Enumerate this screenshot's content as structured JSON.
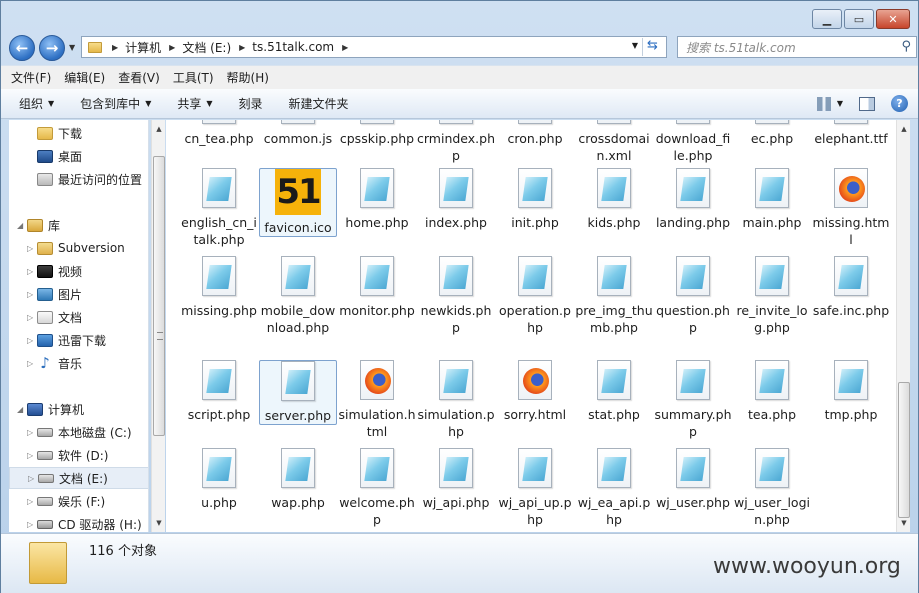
{
  "address": {
    "crumbs": [
      "计算机",
      "文档 (E:)",
      "ts.51talk.com"
    ]
  },
  "search": {
    "placeholder": "搜索 ts.51talk.com"
  },
  "menu": [
    "文件(F)",
    "编辑(E)",
    "查看(V)",
    "工具(T)",
    "帮助(H)"
  ],
  "toolbar": {
    "organize": "组织",
    "include": "包含到库中",
    "share": "共享",
    "burn": "刻录",
    "new_folder": "新建文件夹"
  },
  "sidebar": {
    "items": [
      {
        "label": "下载",
        "icon": "folder-icon"
      },
      {
        "label": "桌面",
        "icon": "desktop-icon"
      },
      {
        "label": "最近访问的位置",
        "icon": "recent-places-icon"
      },
      {
        "label": "库",
        "icon": "library-icon"
      },
      {
        "label": "Subversion",
        "icon": "folder-icon"
      },
      {
        "label": "视频",
        "icon": "video-library-icon"
      },
      {
        "label": "图片",
        "icon": "pictures-library-icon"
      },
      {
        "label": "文档",
        "icon": "documents-library-icon"
      },
      {
        "label": "迅雷下载",
        "icon": "download-library-icon"
      },
      {
        "label": "音乐",
        "icon": "music-library-icon"
      },
      {
        "label": "计算机",
        "icon": "computer-icon"
      },
      {
        "label": "本地磁盘 (C:)",
        "icon": "drive-icon"
      },
      {
        "label": "软件 (D:)",
        "icon": "drive-icon"
      },
      {
        "label": "文档 (E:)",
        "icon": "drive-icon"
      },
      {
        "label": "娱乐 (F:)",
        "icon": "drive-icon"
      },
      {
        "label": "CD 驱动器 (H:)",
        "icon": "cd-drive-icon"
      }
    ]
  },
  "files": [
    [
      "cn_tea.php",
      "common.js",
      "cpsskip.php",
      "crmindex.php",
      "cron.php",
      "crossdomain.xml",
      "download_file.php",
      "ec.php",
      "elephant.ttf"
    ],
    [
      "english_cn_italk.php",
      "favicon.ico",
      "home.php",
      "index.php",
      "init.php",
      "kids.php",
      "landing.php",
      "main.php",
      "missing.html"
    ],
    [
      "missing.php",
      "mobile_download.php",
      "monitor.php",
      "newkids.php",
      "operation.php",
      "pre_img_thumb.php",
      "question.php",
      "re_invite_log.php",
      "safe.inc.php"
    ],
    [
      "script.php",
      "server.php",
      "simulation.html",
      "simulation.php",
      "sorry.html",
      "stat.php",
      "summary.php",
      "tea.php",
      "tmp.php"
    ],
    [
      "u.php",
      "wap.php",
      "welcome.php",
      "wj_api.php",
      "wj_api_up.php",
      "wj_ea_api.php",
      "wj_user.php",
      "wj_user_login.php"
    ]
  ],
  "favicon_text": "51",
  "status": {
    "count": "116 个对象"
  },
  "watermark": "www.wooyun.org"
}
